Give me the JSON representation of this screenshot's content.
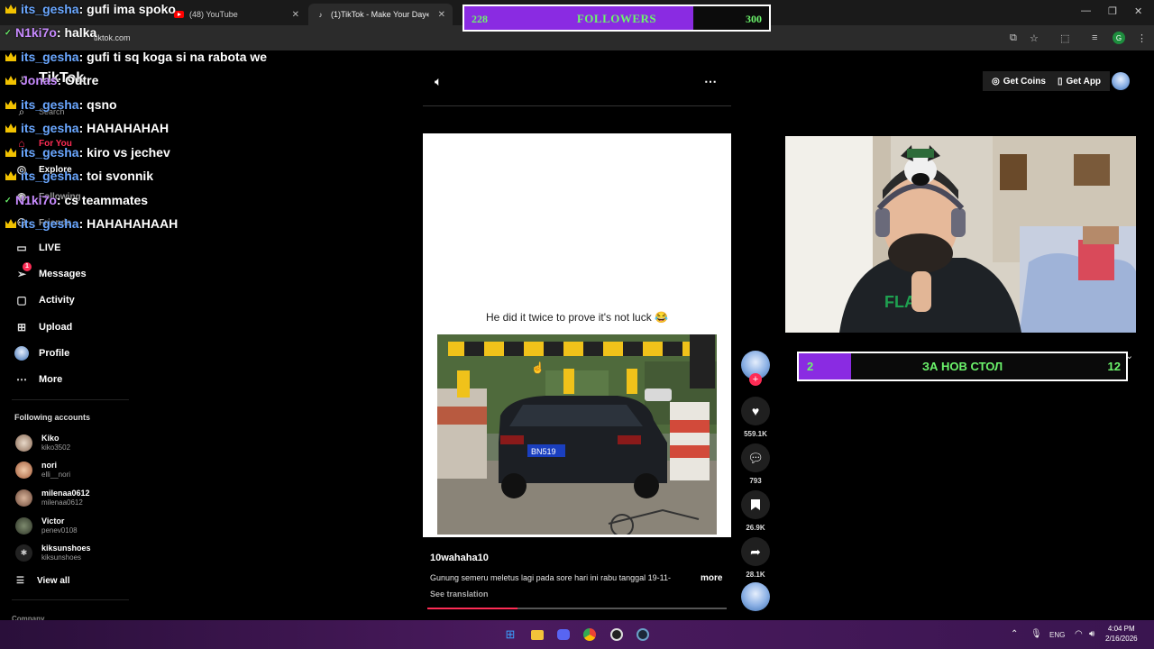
{
  "browser": {
    "tabs": [
      {
        "title": "(48) YouTube",
        "icon": "youtube-icon"
      },
      {
        "title": "(1)TikTok - Make Your Day",
        "icon": "tiktok-icon"
      }
    ],
    "url": "tiktok.com",
    "profile_letter": "G"
  },
  "followers_goal": {
    "current": "228",
    "label": "FOLLOWERS",
    "target": "300",
    "fill_fraction": 0.75,
    "bar_color": "#8a2be2",
    "text_color": "#6cf56c"
  },
  "tiktok": {
    "logo_text": "TikTok",
    "search_placeholder": "Search",
    "nav": [
      {
        "label": "For You",
        "icon": "home-icon"
      },
      {
        "label": "Explore",
        "icon": "compass-icon"
      },
      {
        "label": "Following",
        "icon": "following-icon"
      },
      {
        "label": "Friends",
        "icon": "friends-icon"
      },
      {
        "label": "LIVE",
        "icon": "live-icon"
      },
      {
        "label": "Messages",
        "icon": "send-icon",
        "badge": "1"
      },
      {
        "label": "Activity",
        "icon": "activity-icon"
      },
      {
        "label": "Upload",
        "icon": "upload-icon"
      },
      {
        "label": "Profile",
        "icon": "profile-icon"
      },
      {
        "label": "More",
        "icon": "more-icon"
      }
    ],
    "following_header": "Following accounts",
    "accounts": [
      {
        "name": "Kiko",
        "handle": "kiko3502"
      },
      {
        "name": "nori",
        "handle": "elli__nori"
      },
      {
        "name": "milenaa0612",
        "handle": "milenaa0612"
      },
      {
        "name": "Victor",
        "handle": "penev0108"
      },
      {
        "name": "kiksunshoes",
        "handle": "kiksunshoes"
      }
    ],
    "view_all": "View all",
    "company": "Company"
  },
  "chat": [
    {
      "user": "its_gesha",
      "text": " : gufi ima spoko",
      "badge": "crown",
      "color": "u1"
    },
    {
      "user": "N1ki7o",
      "text": " : halka",
      "badge": "check",
      "color": "u2"
    },
    {
      "user": "its_gesha",
      "text": " : gufi ti sq koga si na rabota we",
      "badge": "crown",
      "color": "u1"
    },
    {
      "user": "Jonas",
      "text": " : Outre",
      "badge": "crown",
      "color": "u2"
    },
    {
      "user": "its_gesha",
      "text": " : qsno",
      "badge": "crown",
      "color": "u1"
    },
    {
      "user": "its_gesha",
      "text": " : HAHAHAHAH",
      "badge": "crown",
      "color": "u1"
    },
    {
      "user": "its_gesha",
      "text": " : kiro vs jechev",
      "badge": "crown",
      "color": "u1"
    },
    {
      "user": "its_gesha",
      "text": " : toi svonnik",
      "badge": "crown",
      "color": "u1"
    },
    {
      "user": "N1ki7o",
      "text": " : cs teammates",
      "badge": "check",
      "color": "u2"
    },
    {
      "user": "its_gesha",
      "text": " : HAHAHAHAAH",
      "badge": "crown",
      "color": "u1"
    }
  ],
  "video": {
    "caption": "He did it twice to prove it's not luck 😂",
    "plate": "BN519",
    "author": "10wahaha10",
    "description": "Gunung semeru meletus lagi pada sore hari ini rabu tanggal 19-11-",
    "more_label": "more",
    "see_translation": "See translation",
    "progress_fraction": 0.3
  },
  "actions": {
    "likes": "559.1K",
    "comments": "793",
    "saves": "26.9K",
    "shares": "28.1K"
  },
  "top_right": {
    "get_coins": "Get Coins",
    "get_app": "Get App"
  },
  "goal2": {
    "current": "2",
    "label": "ЗА НОВ СТОЛ",
    "target": "12",
    "fill_fraction": 0.16
  },
  "taskbar": {
    "language": "ENG",
    "time": "4:04 PM",
    "date": "2/16/2026"
  }
}
